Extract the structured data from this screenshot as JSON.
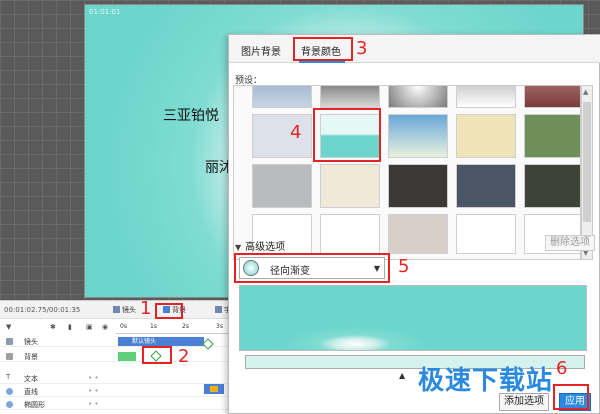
{
  "canvas": {
    "label": "01:01:01",
    "text_line1": "三亚铂悦",
    "text_line2": "丽沐"
  },
  "timeline": {
    "time": "00:01:02.75/00:01:35",
    "btn_camera": "镜头",
    "btn_background": "背景",
    "btn_next": "字",
    "ruler": [
      "0s",
      "1s",
      "2s",
      "3s"
    ],
    "tracks": [
      {
        "name": "镜头",
        "dots": ""
      },
      {
        "name": "背景",
        "dots": ""
      },
      {
        "name": "文本",
        "dots": "•  •"
      },
      {
        "name": "直线",
        "dots": "•  •"
      },
      {
        "name": "椭圆形",
        "dots": "•  •"
      }
    ],
    "clip_label": "默认镜头"
  },
  "dialog": {
    "tabs": [
      "图片背景",
      "背景颜色"
    ],
    "preset_label": "预设：",
    "section_title": "高级选项",
    "delete_label": "删除选项",
    "gradient_type": "径向渐变",
    "add_label": "添加选项",
    "apply_label": "应用"
  },
  "watermark": "极速下载站",
  "annotations": [
    "1",
    "2",
    "3",
    "4",
    "5",
    "6"
  ],
  "colors": {
    "accent": "#2a8ae0",
    "annotation_red": "#e32424",
    "selected_swatch": "#6dd6cc"
  }
}
